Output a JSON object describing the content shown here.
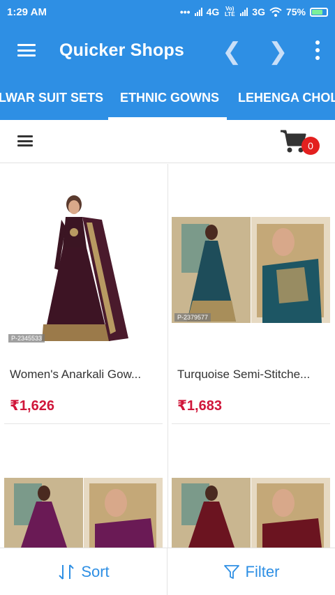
{
  "status": {
    "time": "1:29 AM",
    "network1": "4G",
    "volte": "Vo) LTE",
    "network2": "3G",
    "battery": "75%"
  },
  "app_bar": {
    "title": "Quicker Shops"
  },
  "tabs": [
    {
      "label": "LWAR SUIT SETS",
      "active": false
    },
    {
      "label": "ETHNIC GOWNS",
      "active": true
    },
    {
      "label": "LEHENGA CHOLI",
      "active": false
    }
  ],
  "cart": {
    "count": "0"
  },
  "products": [
    {
      "name": "Women's Anarkali Gow...",
      "price": "₹1,626",
      "code": "P-2345533"
    },
    {
      "name": "Turquoise Semi-Stitche...",
      "price": "₹1,683",
      "code": "P-2379577"
    },
    {
      "name": "",
      "price": "",
      "code": ""
    },
    {
      "name": "",
      "price": "",
      "code": ""
    }
  ],
  "bottom_bar": {
    "sort_label": "Sort",
    "filter_label": "Filter"
  },
  "colors": {
    "primary": "#2e8fe4",
    "price": "#d0163a",
    "badge": "#e3201f"
  }
}
